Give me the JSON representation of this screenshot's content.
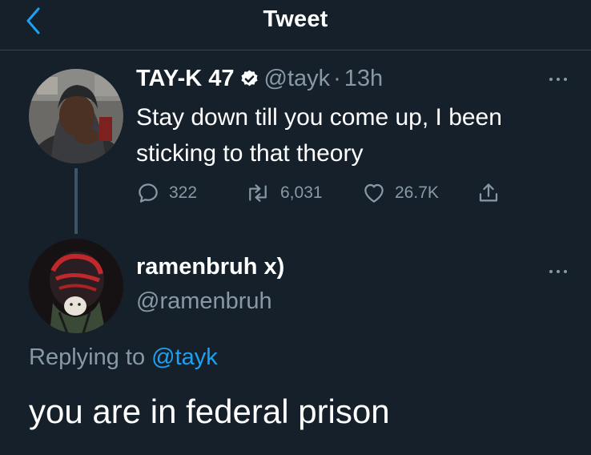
{
  "header": {
    "title": "Tweet",
    "back_icon": "chevron-left-icon",
    "accent": "#1da1f2"
  },
  "original_tweet": {
    "name": "TAY-K 47",
    "verified": true,
    "handle": "@tayk",
    "separator": "·",
    "time": "13h",
    "text": "Stay down till you come up, I been sticking to that theory",
    "actions": {
      "replies": "322",
      "retweets": "6,031",
      "likes": "26.7K"
    }
  },
  "reply_tweet": {
    "name": "ramenbruh x)",
    "handle": "@ramenbruh",
    "replying_prefix": "Replying to",
    "replying_to": "@tayk",
    "text": "you are in federal prison"
  },
  "colors": {
    "background": "#15202b",
    "secondary_text": "#8899a6",
    "divider": "#38444d",
    "verified_badge": "#ffffff"
  }
}
